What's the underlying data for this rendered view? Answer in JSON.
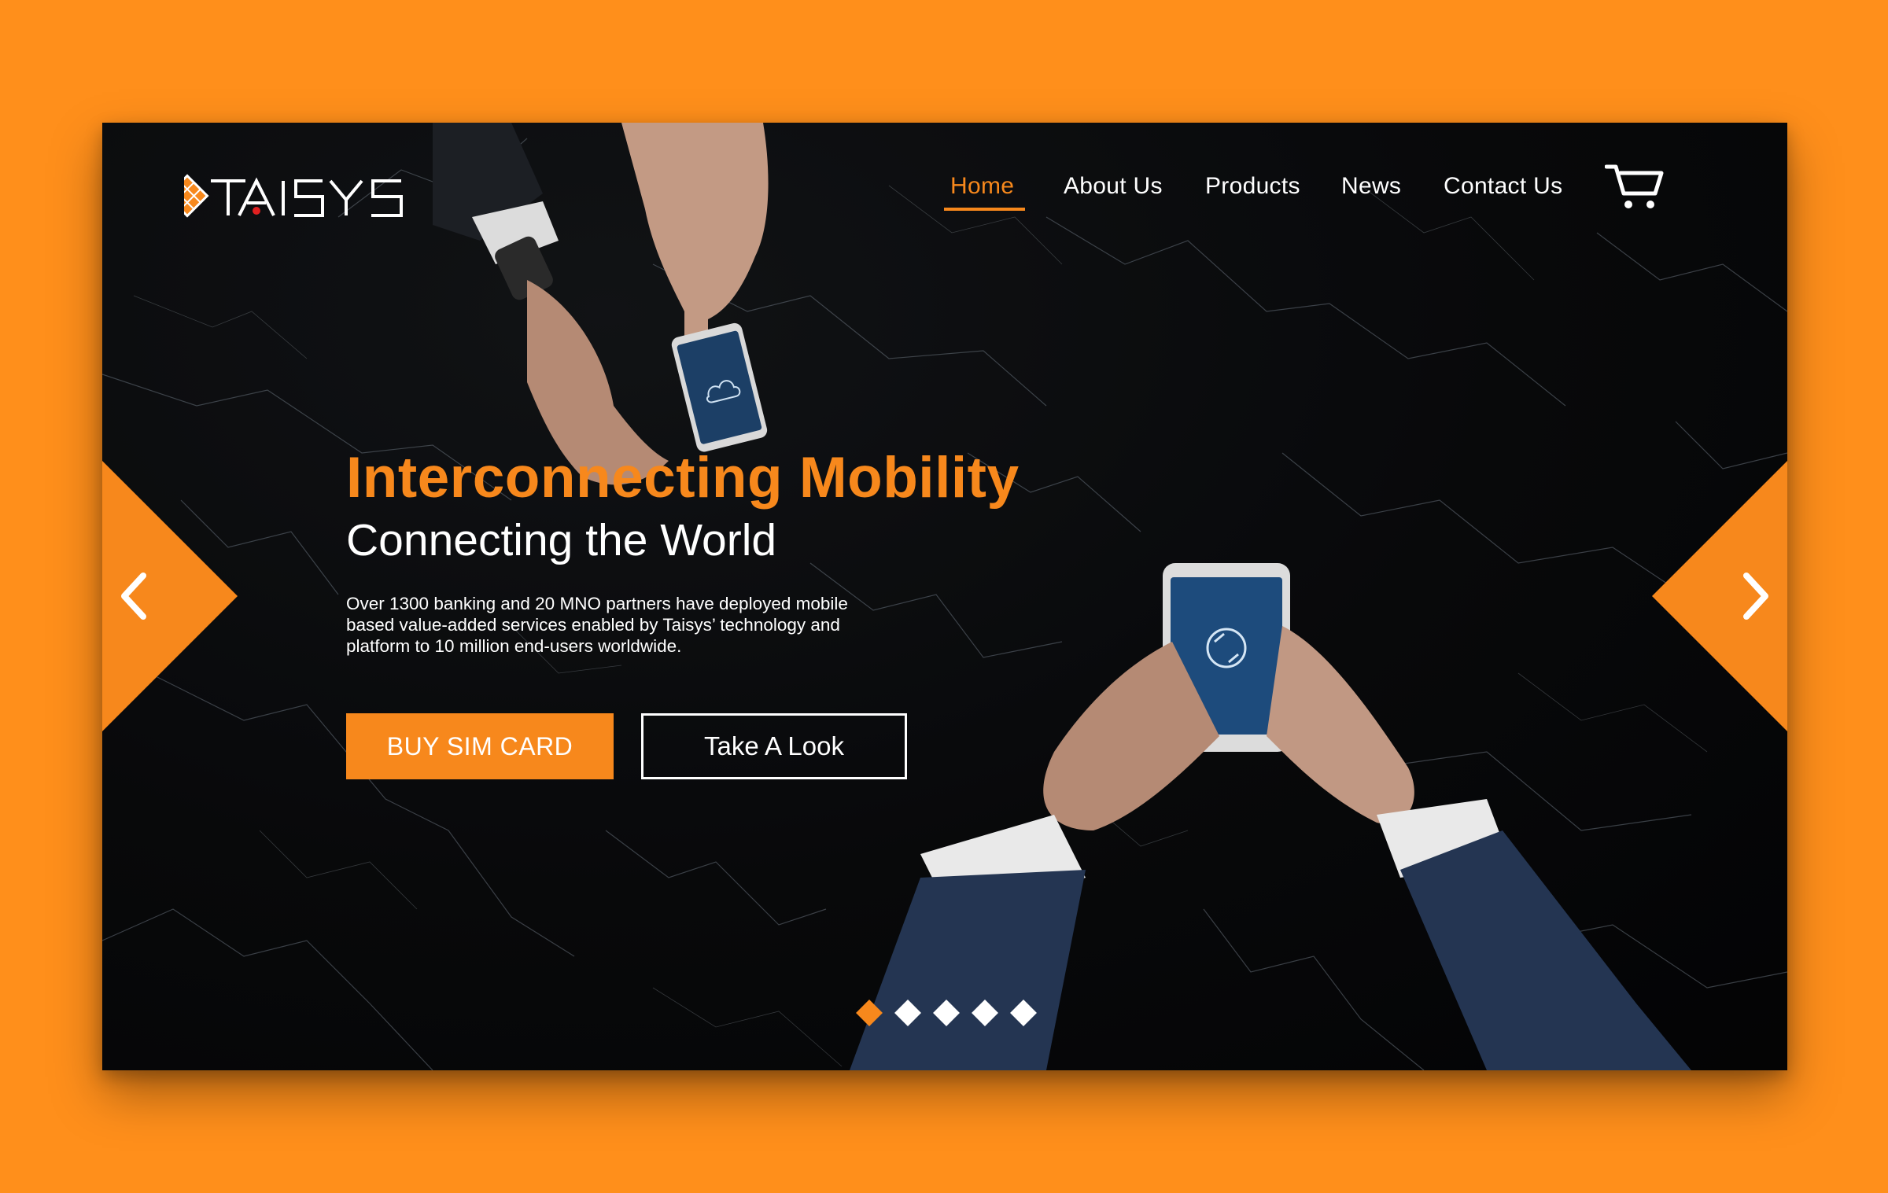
{
  "brand": {
    "logo_text": "TAISYS",
    "accent_color": "#f7881c",
    "background_color": "#ff8f1b"
  },
  "nav": {
    "items": [
      {
        "label": "Home",
        "active": true
      },
      {
        "label": "About Us",
        "active": false
      },
      {
        "label": "Products",
        "active": false
      },
      {
        "label": "News",
        "active": false
      },
      {
        "label": "Contact Us",
        "active": false
      }
    ],
    "cart_icon": "cart-icon"
  },
  "hero": {
    "title": "Interconnecting Mobility",
    "subtitle": "Connecting the World",
    "description_lines": [
      "Over 1300 banking and 20 MNO partners have deployed mobile",
      "based value-added services enabled by Taisys’ technology and",
      "platform to 10 million end-users worldwide."
    ],
    "primary_button": "BUY SIM CARD",
    "secondary_button": "Take A Look"
  },
  "carousel": {
    "prev_icon": "chevron-left-icon",
    "next_icon": "chevron-right-icon",
    "slide_count": 5,
    "active_slide": 1
  }
}
